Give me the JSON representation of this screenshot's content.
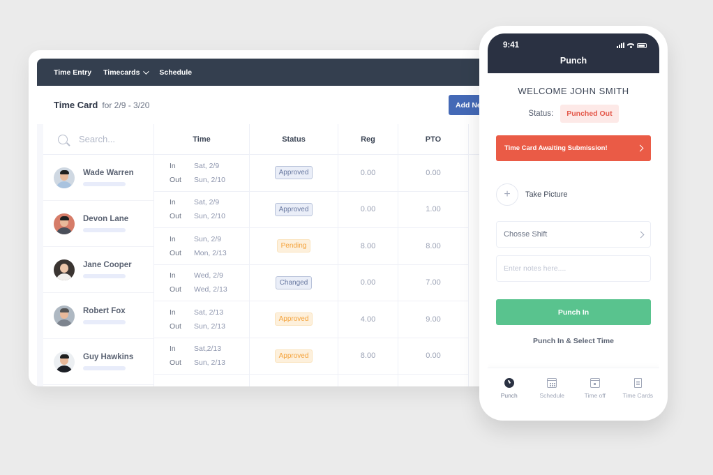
{
  "desktop": {
    "nav": [
      {
        "label": "Time Entry",
        "has_dropdown": false
      },
      {
        "label": "Timecards",
        "has_dropdown": true
      },
      {
        "label": "Schedule",
        "has_dropdown": false
      }
    ],
    "title": "Time Card",
    "date_range": "for 2/9 - 3/20",
    "add_button": "Add Ne",
    "search_placeholder": "Search...",
    "columns": [
      "Time",
      "Status",
      "Reg",
      "PTO"
    ],
    "people": [
      {
        "name": "Wade Warren",
        "avatar": "avatar-wade"
      },
      {
        "name": "Devon Lane",
        "avatar": "avatar-devon"
      },
      {
        "name": "Jane Cooper",
        "avatar": "avatar-jane"
      },
      {
        "name": "Robert Fox",
        "avatar": "avatar-robert"
      },
      {
        "name": "Guy Hawkins",
        "avatar": "avatar-guy"
      }
    ],
    "rows": [
      {
        "in_label": "In",
        "in": "Sat, 2/9",
        "out_label": "Out",
        "out": "Sun, 2/10",
        "status": "Approved",
        "status_style": "approved",
        "reg": "0.00",
        "pto": "0.00"
      },
      {
        "in_label": "In",
        "in": "Sat, 2/9",
        "out_label": "Out",
        "out": "Sun, 2/10",
        "status": "Approved",
        "status_style": "approved",
        "reg": "0.00",
        "pto": "1.00"
      },
      {
        "in_label": "In",
        "in": "Sun, 2/9",
        "out_label": "Out",
        "out": "Mon, 2/13",
        "status": "Pending",
        "status_style": "pending",
        "reg": "8.00",
        "pto": "8.00"
      },
      {
        "in_label": "In",
        "in": "Wed, 2/9",
        "out_label": "Out",
        "out": "Wed, 2/13",
        "status": "Changed",
        "status_style": "changed",
        "reg": "0.00",
        "pto": "7.00"
      },
      {
        "in_label": "In",
        "in": "Sat, 2/13",
        "out_label": "Out",
        "out": "Sun, 2/13",
        "status": "Approved",
        "status_style": "approved-warm",
        "reg": "4.00",
        "pto": "9.00"
      },
      {
        "in_label": "In",
        "in": "Sat,2/13",
        "out_label": "Out",
        "out": "Sun, 2/13",
        "status": "Approved",
        "status_style": "approved-warm",
        "reg": "8.00",
        "pto": "0.00"
      }
    ]
  },
  "phone": {
    "clock": "9:41",
    "header_title": "Punch",
    "welcome": "WELCOME JOHN SMITH",
    "status_label": "Status:",
    "status_value": "Punched Out",
    "alert": "Time Card Awaiting Submission!",
    "take_picture": "Take Picture",
    "shift_field": "Chosse Shift",
    "notes_placeholder": "Enter notes here....",
    "punch_in": "Punch In",
    "punch_select": "Punch In & Select Time",
    "tabs": [
      {
        "label": "Punch",
        "icon": "clock-icon",
        "active": true
      },
      {
        "label": "Schedule",
        "icon": "calendar-icon",
        "active": false
      },
      {
        "label": "Time off",
        "icon": "calendar-day-icon",
        "active": false
      },
      {
        "label": "Time Cards",
        "icon": "document-icon",
        "active": false
      }
    ]
  },
  "colors": {
    "nav_bg": "#343f4f",
    "phone_header_bg": "#2a3142",
    "primary_button": "#4469b6",
    "alert": "#ea5b46",
    "success": "#59c38e",
    "status_punched_out": "#e4584a"
  }
}
